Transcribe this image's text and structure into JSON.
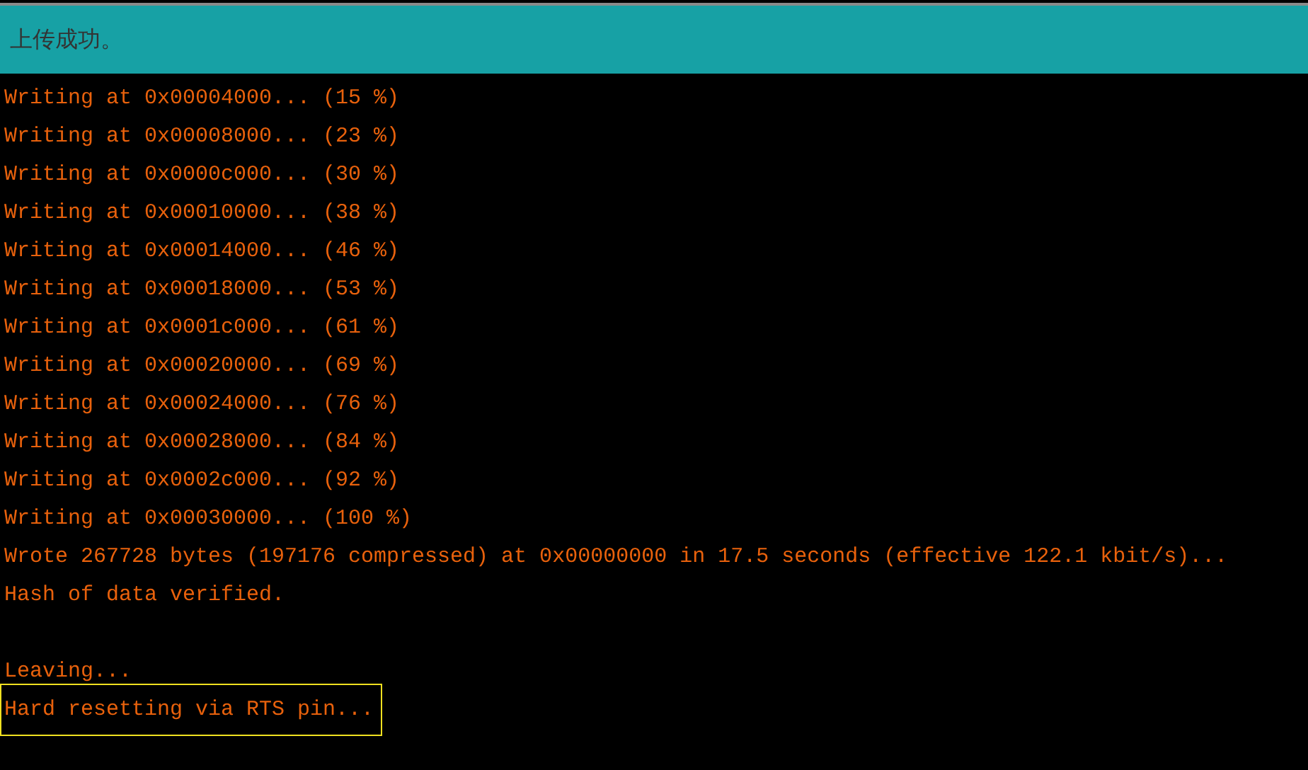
{
  "status_bar": {
    "message": "上传成功。"
  },
  "console": {
    "groups": [
      {
        "lines": [
          {
            "text": "Writing at 0x00004000... (15 %)",
            "highlighted": false
          },
          {
            "text": "Writing at 0x00008000... (23 %)",
            "highlighted": false
          },
          {
            "text": "Writing at 0x0000c000... (30 %)",
            "highlighted": false
          },
          {
            "text": "Writing at 0x00010000... (38 %)",
            "highlighted": false
          },
          {
            "text": "Writing at 0x00014000... (46 %)",
            "highlighted": false
          },
          {
            "text": "Writing at 0x00018000... (53 %)",
            "highlighted": false
          },
          {
            "text": "Writing at 0x0001c000... (61 %)",
            "highlighted": false
          },
          {
            "text": "Writing at 0x00020000... (69 %)",
            "highlighted": false
          },
          {
            "text": "Writing at 0x00024000... (76 %)",
            "highlighted": false
          },
          {
            "text": "Writing at 0x00028000... (84 %)",
            "highlighted": false
          },
          {
            "text": "Writing at 0x0002c000... (92 %)",
            "highlighted": false
          },
          {
            "text": "Writing at 0x00030000... (100 %)",
            "highlighted": false
          },
          {
            "text": "Wrote 267728 bytes (197176 compressed) at 0x00000000 in 17.5 seconds (effective 122.1 kbit/s)...",
            "highlighted": false
          },
          {
            "text": "Hash of data verified.",
            "highlighted": false
          }
        ]
      },
      {
        "lines": [
          {
            "text": "Leaving...",
            "highlighted": false
          },
          {
            "text": "Hard resetting via RTS pin...",
            "highlighted": true
          }
        ]
      }
    ]
  }
}
